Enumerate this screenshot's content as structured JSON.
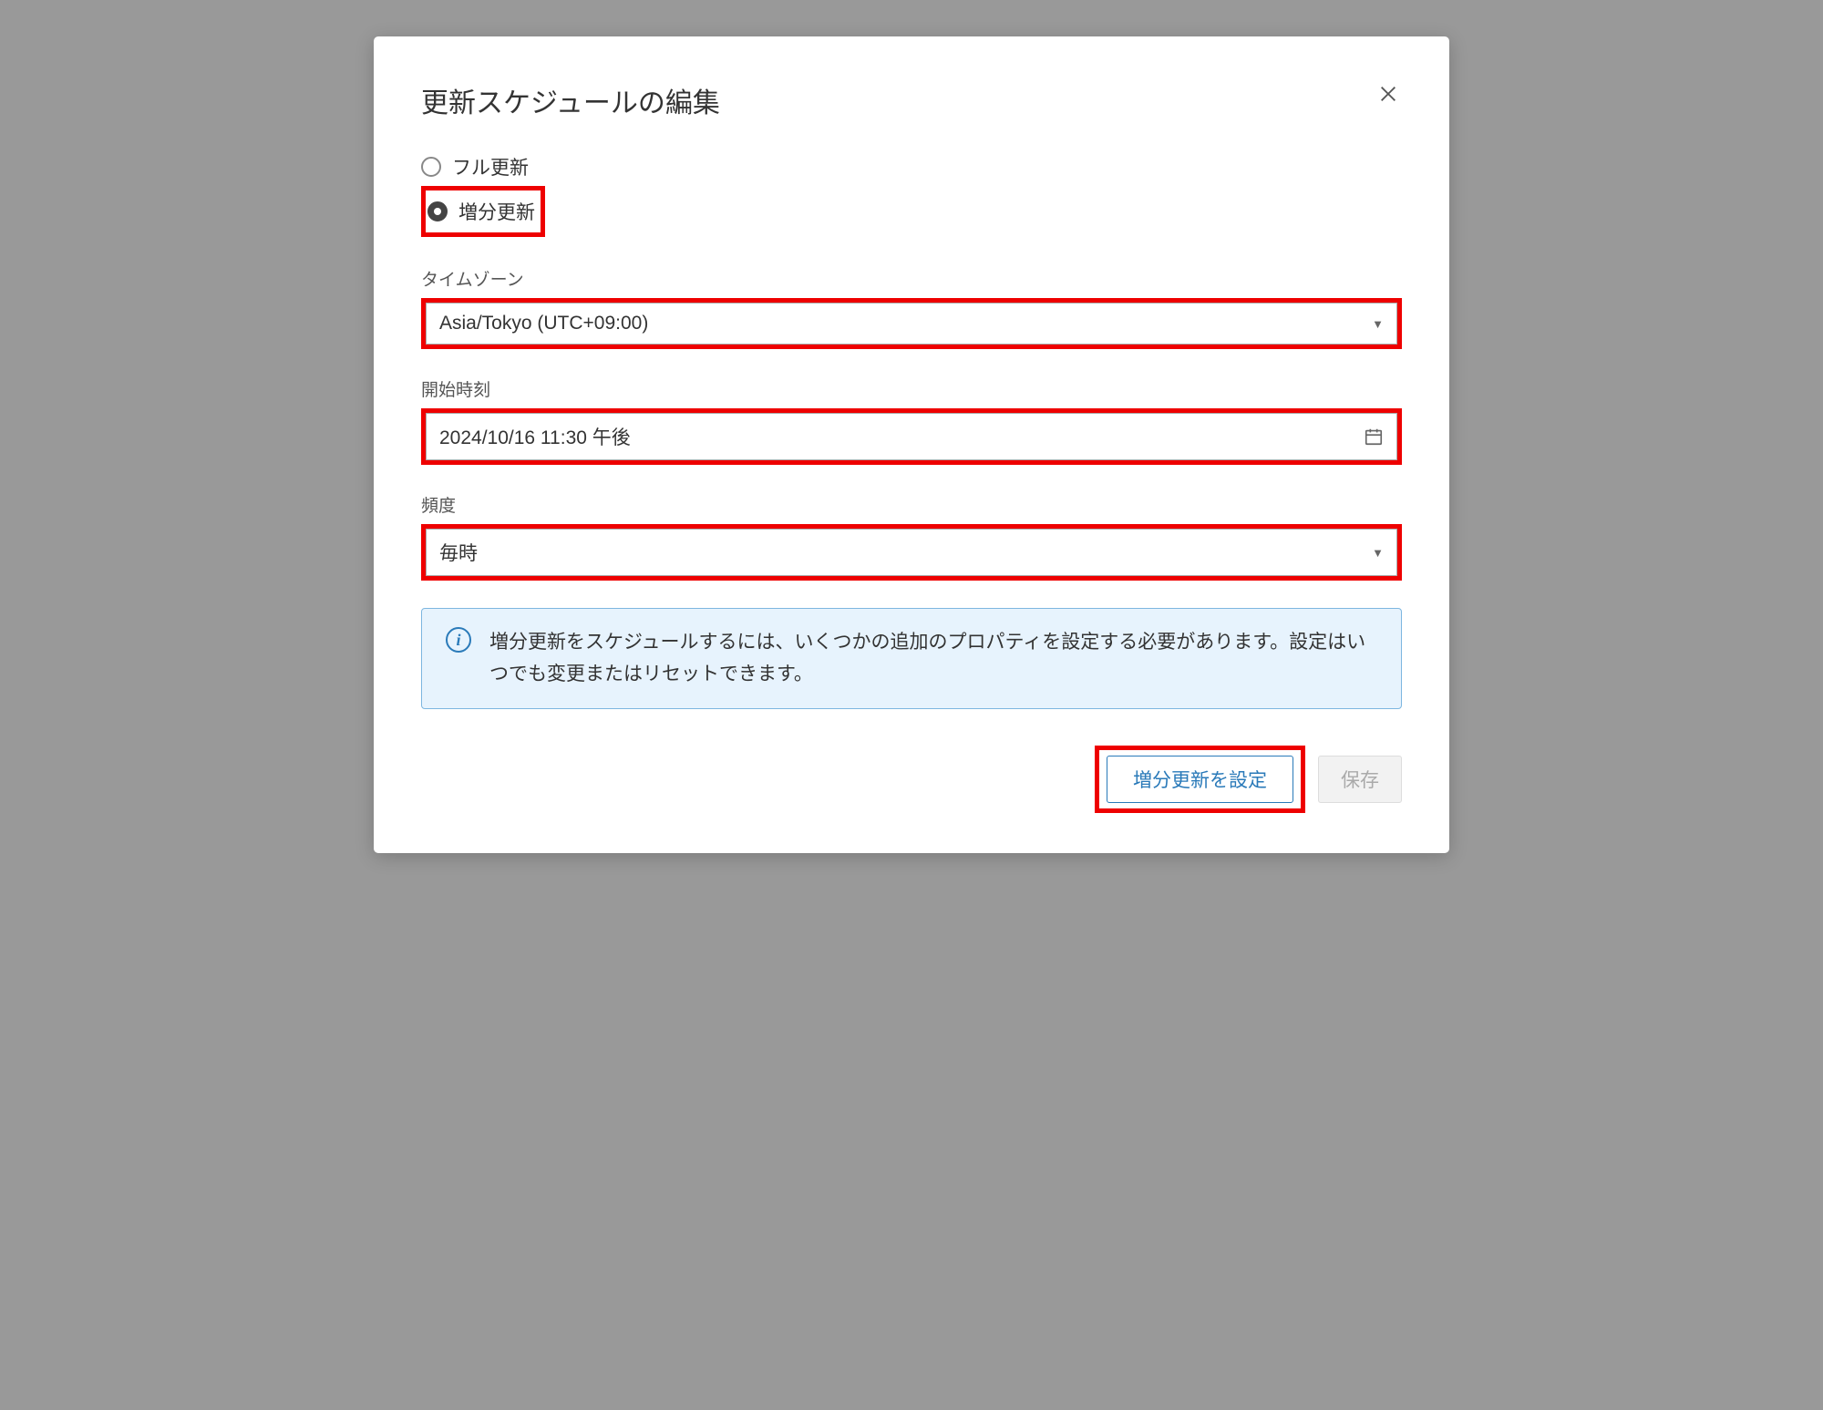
{
  "modal": {
    "title": "更新スケジュールの編集",
    "radio": {
      "full": "フル更新",
      "incremental": "増分更新"
    },
    "timezone": {
      "label": "タイムゾーン",
      "value": "Asia/Tokyo (UTC+09:00)"
    },
    "startTime": {
      "label": "開始時刻",
      "value": "2024/10/16 11:30 午後"
    },
    "frequency": {
      "label": "頻度",
      "value": "毎時"
    },
    "info": "増分更新をスケジュールするには、いくつかの追加のプロパティを設定する必要があります。設定はいつでも変更またはリセットできます。",
    "buttons": {
      "configure": "増分更新を設定",
      "save": "保存"
    }
  }
}
